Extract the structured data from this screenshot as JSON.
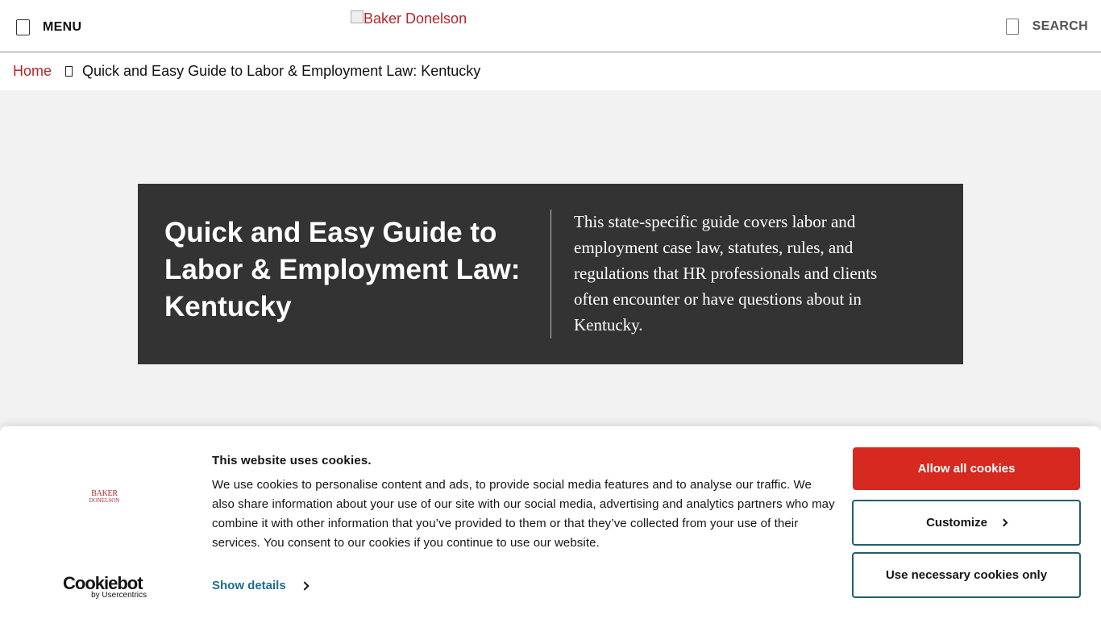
{
  "header": {
    "menu_label": "MENU",
    "logo_alt": "Baker Donelson",
    "search_label": "SEARCH"
  },
  "breadcrumb": {
    "home": "Home",
    "current": "Quick and Easy Guide to Labor & Employment Law: Kentucky"
  },
  "hero": {
    "title": "Quick and Easy Guide to Labor & Employment Law: Kentucky",
    "description": "This state-specific guide covers labor and employment case law, statutes, rules, and regulations that HR professionals and clients often encounter or have questions about in Kentucky."
  },
  "cookie_banner": {
    "logo_line1": "BAKER",
    "logo_line2": "DONELSON",
    "provider_name": "Cookiebot",
    "provider_sub": "by Usercentrics",
    "title": "This website uses cookies.",
    "text": "We use cookies to personalise content and ads, to provide social media features and to analyse our traffic. We also share information about your use of our site with our social media, advertising and analytics partners who may combine it with other information that you’ve provided to them or that they’ve collected from your use of their services. You consent to our cookies if you continue to use our website.",
    "show_details": "Show details",
    "allow_all": "Allow all cookies",
    "customize": "Customize",
    "necessary_only": "Use necessary cookies only"
  },
  "colors": {
    "brand_red": "#b5262b",
    "allow_button": "#d6291f",
    "hero_bg": "#333333",
    "link_teal": "#1f6d8c"
  }
}
